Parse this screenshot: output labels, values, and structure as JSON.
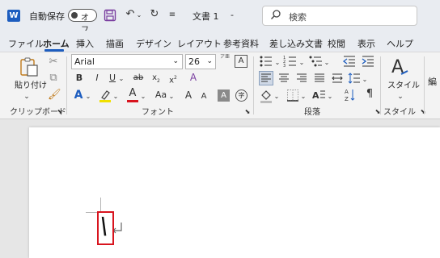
{
  "titlebar": {
    "app_icon": "W",
    "autosave_label": "自動保存",
    "autosave_state": "オフ",
    "doc_title": "文書 1",
    "doc_title_suffix": "-",
    "search_placeholder": "検索"
  },
  "menu": {
    "items": [
      "ファイル",
      "ホーム",
      "挿入",
      "描画",
      "デザイン",
      "レイアウト",
      "参考資料",
      "差し込み文書",
      "校閲",
      "表示",
      "ヘルプ"
    ],
    "active": "ホーム"
  },
  "clipboard": {
    "paste_label": "貼り付け",
    "group_label": "クリップボード"
  },
  "font": {
    "font_name": "Arial",
    "font_size": "26",
    "group_label": "フォント",
    "bold": "B",
    "italic": "I",
    "underline": "U",
    "strike": "ab",
    "subscript": "x",
    "superscript": "x",
    "grow": "A",
    "shrink": "A",
    "case": "Aa",
    "clear_a": "A",
    "char_shade": "A",
    "enclose": "字",
    "ruby": "ア亜",
    "border_char": "A"
  },
  "paragraph": {
    "group_label": "段落"
  },
  "styles": {
    "label": "スタイル",
    "group_label": "スタイル",
    "edit_label": "編"
  },
  "document": {
    "text": "\\"
  }
}
